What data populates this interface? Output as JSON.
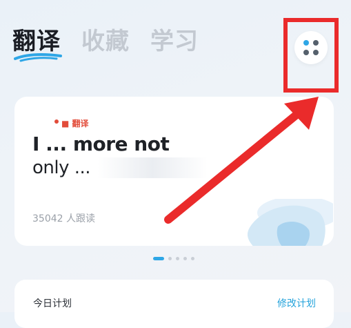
{
  "tabs": [
    {
      "label": "翻译",
      "active": true
    },
    {
      "label": "收藏",
      "active": false
    },
    {
      "label": "学习",
      "active": false
    }
  ],
  "menu_button": {
    "icon": "four-dots-icon",
    "accent_color": "#2ea6e6"
  },
  "annotation": {
    "box_color": "#ea2b2b"
  },
  "featured_card": {
    "tag": "■ 翻译",
    "sentence_line1": "I ... more not",
    "sentence_line2": "only ...",
    "readers": "35042 人跟读"
  },
  "carousel": {
    "total": 5,
    "active_index": 0
  },
  "plan": {
    "title": "今日计划",
    "edit_link": "修改计划"
  },
  "colors": {
    "accent": "#2ea6e6",
    "link": "#24a3db",
    "annotation_red": "#ea2b2b"
  }
}
